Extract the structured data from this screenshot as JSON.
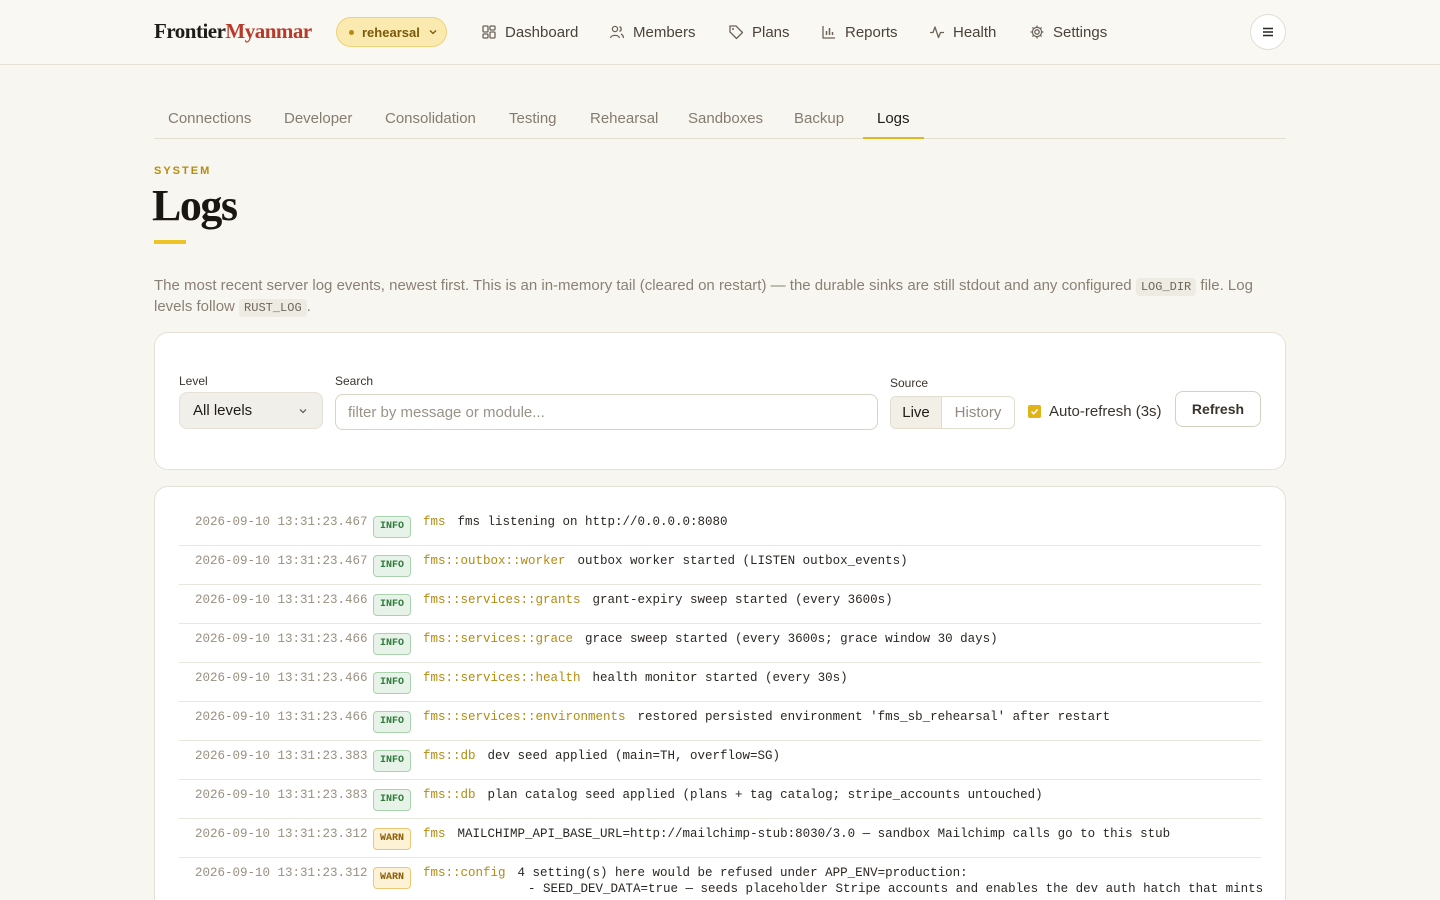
{
  "brand": {
    "name_part1": "Frontier",
    "name_part2": "Myanmar"
  },
  "environment": {
    "label": "rehearsal"
  },
  "nav": [
    {
      "label": "Dashboard",
      "icon": "dashboard-icon"
    },
    {
      "label": "Members",
      "icon": "members-icon"
    },
    {
      "label": "Plans",
      "icon": "tag-icon"
    },
    {
      "label": "Reports",
      "icon": "bar-chart-icon"
    },
    {
      "label": "Health",
      "icon": "pulse-icon"
    },
    {
      "label": "Settings",
      "icon": "gear-icon"
    }
  ],
  "subtabs": [
    {
      "label": "Connections"
    },
    {
      "label": "Developer"
    },
    {
      "label": "Consolidation"
    },
    {
      "label": "Testing"
    },
    {
      "label": "Rehearsal"
    },
    {
      "label": "Sandboxes"
    },
    {
      "label": "Backup"
    },
    {
      "label": "Logs",
      "active": true
    }
  ],
  "header": {
    "eyebrow": "SYSTEM",
    "title": "Logs",
    "desc_part1": "The most recent server log events, newest first. This is an in-memory tail (cleared on restart) — the durable sinks are still stdout and any configured ",
    "desc_code1": "LOG_DIR",
    "desc_part2": " file. Log levels follow ",
    "desc_code2": "RUST_LOG",
    "desc_part3": "."
  },
  "filters": {
    "level_label": "Level",
    "level_value": "All levels",
    "search_label": "Search",
    "search_placeholder": "filter by message or module...",
    "search_value": "",
    "source_label": "Source",
    "source_options": [
      "Live",
      "History"
    ],
    "source_selected": "Live",
    "auto_refresh_label": "Auto-refresh (3s)",
    "auto_refresh_checked": true,
    "refresh_label": "Refresh"
  },
  "colors": {
    "accent": "#e2b720",
    "brand_red": "#b73a2a",
    "info": "#2f7a3b",
    "warn": "#8a5e08",
    "module": "#b48a10"
  },
  "logs": [
    {
      "timestamp": "2026-09-10 13:31:23.467",
      "level": "INFO",
      "module": "fms",
      "message": "fms listening on http://0.0.0.0:8080"
    },
    {
      "timestamp": "2026-09-10 13:31:23.467",
      "level": "INFO",
      "module": "fms::outbox::worker",
      "message": "outbox worker started (LISTEN outbox_events)"
    },
    {
      "timestamp": "2026-09-10 13:31:23.466",
      "level": "INFO",
      "module": "fms::services::grants",
      "message": "grant-expiry sweep started (every 3600s)"
    },
    {
      "timestamp": "2026-09-10 13:31:23.466",
      "level": "INFO",
      "module": "fms::services::grace",
      "message": "grace sweep started (every 3600s; grace window 30 days)"
    },
    {
      "timestamp": "2026-09-10 13:31:23.466",
      "level": "INFO",
      "module": "fms::services::health",
      "message": "health monitor started (every 30s)"
    },
    {
      "timestamp": "2026-09-10 13:31:23.466",
      "level": "INFO",
      "module": "fms::services::environments",
      "message": "restored persisted environment 'fms_sb_rehearsal' after restart"
    },
    {
      "timestamp": "2026-09-10 13:31:23.383",
      "level": "INFO",
      "module": "fms::db",
      "message": "dev seed applied (main=TH, overflow=SG)"
    },
    {
      "timestamp": "2026-09-10 13:31:23.383",
      "level": "INFO",
      "module": "fms::db",
      "message": "plan catalog seed applied (plans + tag catalog; stripe_accounts untouched)"
    },
    {
      "timestamp": "2026-09-10 13:31:23.312",
      "level": "WARN",
      "module": "fms",
      "message": "MAILCHIMP_API_BASE_URL=http://mailchimp-stub:8030/3.0 — sandbox Mailchimp calls go to this stub"
    },
    {
      "timestamp": "2026-09-10 13:31:23.312",
      "level": "WARN",
      "module": "fms::config",
      "message": "4 setting(s) here would be refused under APP_ENV=production:",
      "continuation": "- SEED_DEV_DATA=true — seeds placeholder Stripe accounts and enables the dev auth hatch that mints"
    }
  ]
}
